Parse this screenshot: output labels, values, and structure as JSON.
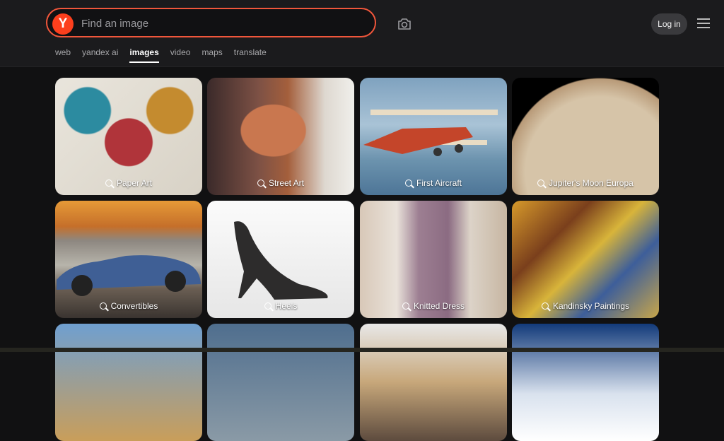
{
  "header": {
    "logo_letter": "Y",
    "search_placeholder": "Find an image",
    "login_label": "Log in"
  },
  "tabs": [
    {
      "label": "web",
      "active": false
    },
    {
      "label": "yandex ai",
      "active": false
    },
    {
      "label": "images",
      "active": true
    },
    {
      "label": "video",
      "active": false
    },
    {
      "label": "maps",
      "active": false
    },
    {
      "label": "translate",
      "active": false
    }
  ],
  "cards": [
    {
      "label": "Paper Art"
    },
    {
      "label": "Street Art"
    },
    {
      "label": "First Aircraft"
    },
    {
      "label": "Jupiter's Moon Europa"
    },
    {
      "label": "Convertibles"
    },
    {
      "label": "Heels"
    },
    {
      "label": "Knitted Dress"
    },
    {
      "label": "Kandinsky Paintings"
    }
  ],
  "colors": {
    "accent": "#f0563b",
    "logo": "#fc3f1d",
    "background": "#111112"
  }
}
